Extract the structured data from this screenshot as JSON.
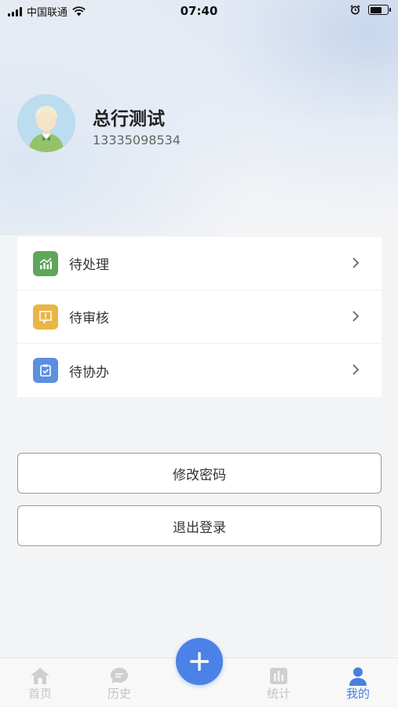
{
  "status_bar": {
    "carrier": "中国联通",
    "time": "07:40"
  },
  "profile": {
    "name": "总行测试",
    "phone": "13335098534"
  },
  "menu": {
    "items": [
      {
        "label": "待处理",
        "icon": "chart-icon",
        "color": "#5fa65a"
      },
      {
        "label": "待审核",
        "icon": "alert-message-icon",
        "color": "#e9b545"
      },
      {
        "label": "待协办",
        "icon": "clipboard-icon",
        "color": "#5b8fe0"
      }
    ]
  },
  "actions": {
    "change_password": "修改密码",
    "logout": "退出登录"
  },
  "tabs": [
    {
      "label": "首页",
      "icon": "home-icon"
    },
    {
      "label": "历史",
      "icon": "history-icon"
    },
    {
      "label": "统计",
      "icon": "stats-icon"
    },
    {
      "label": "我的",
      "icon": "user-icon",
      "active": true
    }
  ],
  "colors": {
    "accent": "#4a82e8",
    "tab_active": "#4a7fde",
    "tab_inactive": "#c4c4c4"
  }
}
